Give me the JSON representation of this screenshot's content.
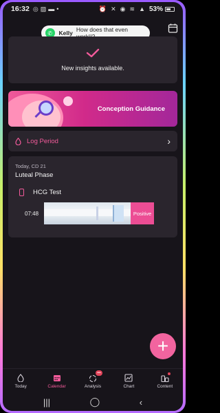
{
  "status_bar": {
    "time": "16:32",
    "battery": "53%"
  },
  "notification": {
    "sender": "Kelly",
    "message": "How does that even work!!?"
  },
  "insights": {
    "text": "New insights available."
  },
  "banner": {
    "title": "Conception Guidance"
  },
  "log_period": {
    "label": "Log Period"
  },
  "phase_card": {
    "date": "Today, CD 21",
    "phase": "Luteal Phase",
    "test_name": "HCG Test",
    "test_time": "07:48",
    "result": "Positive"
  },
  "fab": {
    "label": "+"
  },
  "bottom_nav": {
    "items": [
      {
        "label": "Today",
        "icon": "drop-icon"
      },
      {
        "label": "Calendar",
        "icon": "calendar-icon",
        "active": true
      },
      {
        "label": "Analysis",
        "icon": "analysis-icon",
        "badge": "•••"
      },
      {
        "label": "Chart",
        "icon": "chart-icon"
      },
      {
        "label": "Content",
        "icon": "content-icon"
      }
    ]
  },
  "colors": {
    "accent": "#f35b9b",
    "background": "#17141a",
    "card": "#2a252d"
  }
}
